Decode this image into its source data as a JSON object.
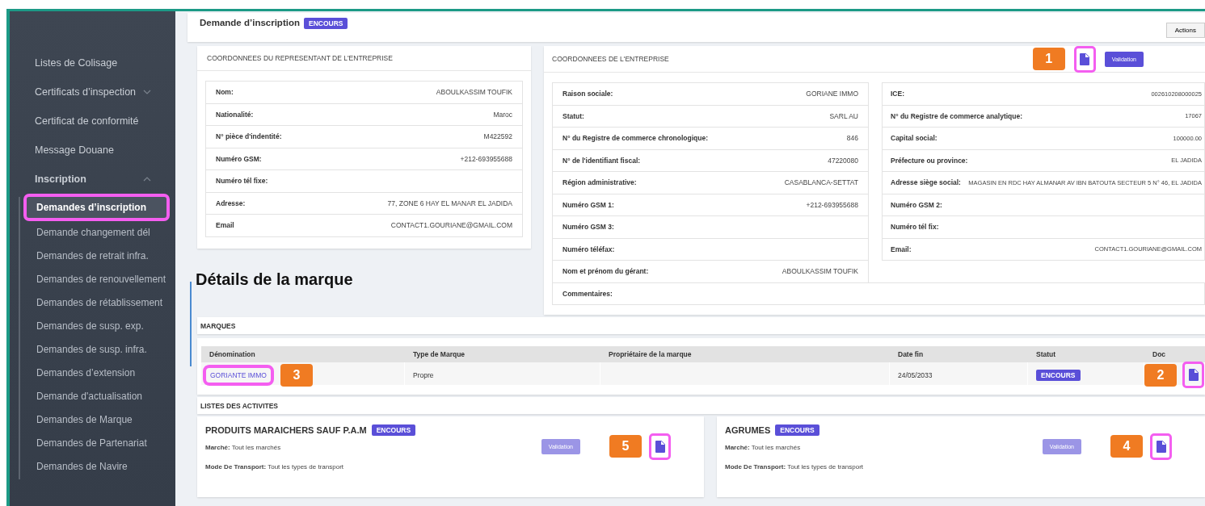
{
  "sidebar": {
    "items": [
      {
        "label": "Listes de Colisage",
        "selected": false
      },
      {
        "label": "Certificats d’inspection",
        "selected": false,
        "expanded": false
      },
      {
        "label": "Certificat de conformité",
        "selected": false
      },
      {
        "label": "Message Douane",
        "selected": false
      },
      {
        "label": "Inscription",
        "selected": false,
        "expanded": true,
        "children": [
          {
            "label": "Demandes d’inscription",
            "selected": true,
            "callout_highlight": true
          },
          {
            "label": "Demande changement dél",
            "selected": false
          },
          {
            "label": "Demandes de retrait infra.",
            "selected": false
          },
          {
            "label": "Demandes de renouvellement",
            "selected": false
          },
          {
            "label": "Demandes de rétablissement",
            "selected": false
          },
          {
            "label": "Demandes de susp. exp.",
            "selected": false
          },
          {
            "label": "Demandes de susp. infra.",
            "selected": false
          },
          {
            "label": "Demandes d’extension",
            "selected": false
          },
          {
            "label": "Demande d'actualisation",
            "selected": false
          },
          {
            "label": "Demandes de Marque",
            "selected": false
          },
          {
            "label": "Demandes de Partenariat",
            "selected": false
          },
          {
            "label": "Demandes de Navire",
            "selected": false
          }
        ]
      }
    ]
  },
  "header": {
    "title": "Demande d’inscription",
    "status": "ENCOURS",
    "actions": "Actions"
  },
  "representative": {
    "title": "COORDONNEES DU REPRESENTANT DE L'ENTREPRISE",
    "fields": [
      {
        "label": "Nom:",
        "value": "ABOULKASSIM TOUFIK"
      },
      {
        "label": "Nationalité:",
        "value": "Maroc"
      },
      {
        "label": "N° pièce d'indentité:",
        "value": "M422592"
      },
      {
        "label": "Numéro GSM:",
        "value": "+212-693955688"
      },
      {
        "label": "Numéro tél fixe:"
      },
      {
        "label": "Adresse:",
        "value": "77, ZONE 6 HAY EL MANAR EL JADIDA"
      },
      {
        "label": "Email",
        "value": "CONTACT1.GOURIANE@GMAIL.COM"
      }
    ]
  },
  "company": {
    "title": "COORDONNEES DE L'ENTREPRISE",
    "callout": "1",
    "doc_highlighted": true,
    "validation": {
      "label": "Validation",
      "disabled": false
    },
    "left_fields": [
      {
        "label": "Raison sociale:",
        "value": "GORIANE IMMO"
      },
      {
        "label": "Statut:",
        "value": "SARL AU"
      },
      {
        "label": "N° du Registre de commerce chronologique:",
        "value": "846"
      },
      {
        "label": "N° de l'identifiant fiscal:",
        "value": "47220080"
      },
      {
        "label": "Région administrative:",
        "value": "CASABLANCA-SETTAT"
      },
      {
        "label": "Numéro GSM 1:",
        "value": "+212-693955688"
      },
      {
        "label": "Numéro GSM 3:"
      },
      {
        "label": "Numéro téléfax:"
      },
      {
        "label": "Nom et prénom du gérant:",
        "value": "ABOULKASSIM TOUFIK"
      }
    ],
    "right_fields": [
      {
        "label": "ICE:",
        "value": "002610208000025"
      },
      {
        "label": "N° du Registre de commerce analytique:",
        "value": "17067"
      },
      {
        "label": "Capital social:",
        "value": "100000.00"
      },
      {
        "label": "Préfecture ou province:",
        "value": "EL JADIDA"
      },
      {
        "label": "Adresse siège social:",
        "value": "MAGASIN EN RDC HAY ALMANAR AV IBN BATOUTA SECTEUR 5 N° 46, EL JADIDA"
      },
      {
        "label": "Numéro GSM 2:"
      },
      {
        "label": "Numéro tél fix:"
      },
      {
        "label": "Email:",
        "value": "CONTACT1.GOURIANE@GMAIL.COM"
      }
    ],
    "comments_label": "Commentaires:"
  },
  "annotation": {
    "title": "Détails de la marque"
  },
  "marques": {
    "title": "MARQUES",
    "columns": [
      "Dénomination",
      "Type de Marque",
      "Propriétaire de la marque",
      "Date fin",
      "Statut",
      "Doc"
    ],
    "rows": [
      {
        "denomination": "GORIANTE IMMO",
        "denomination_callout": "3",
        "denomination_highlighted": true,
        "type": "Propre",
        "date": "24/05/2033",
        "status": "ENCOURS",
        "doc_callout": "2",
        "doc_highlighted": true
      }
    ]
  },
  "activities": {
    "title": "LISTES DES ACTIVITES",
    "items": [
      {
        "name": "PRODUITS MARAICHERS SAUF P.A.M",
        "status": "ENCOURS",
        "market": "**Marché:** Tout les marchés",
        "transport": "**Mode De Transport:** Tout les types de transport",
        "validation": {
          "label": "Validation",
          "disabled": true
        },
        "callout": "5",
        "doc_highlighted": true
      },
      {
        "name": "AGRUMES",
        "status": "ENCOURS",
        "market": "**Marché:** Tout les marchés",
        "transport": "**Mode De Transport:** Tout les types de transport",
        "validation": {
          "label": "Validation",
          "disabled": true
        },
        "callout": "4",
        "doc_highlighted": true
      }
    ]
  }
}
